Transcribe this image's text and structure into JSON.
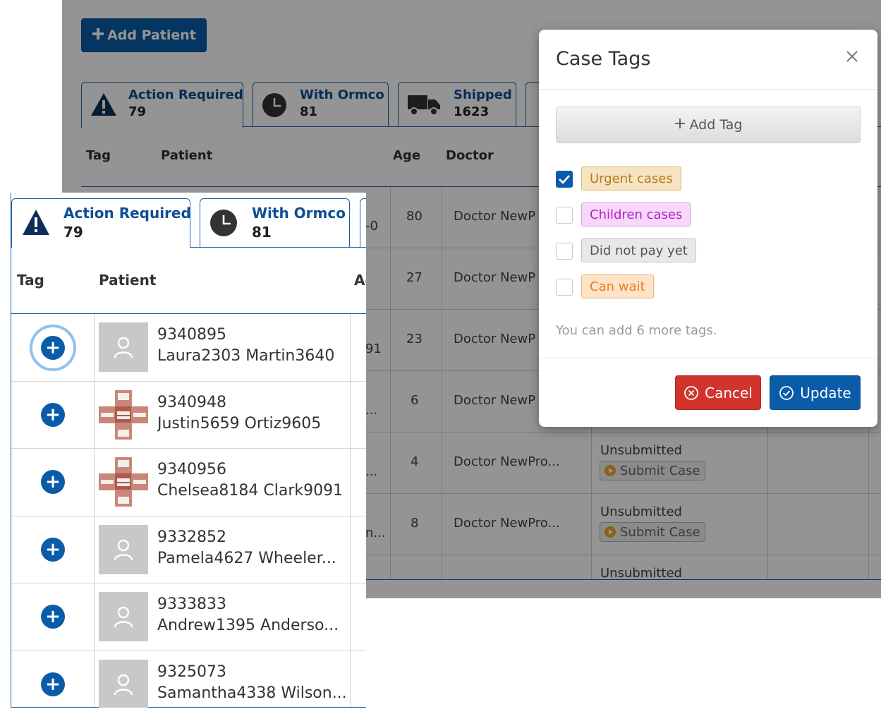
{
  "background": {
    "add_patient_label": "Add Patient",
    "tabs": [
      {
        "label": "Action Required",
        "count": "79",
        "icon": "warning-icon"
      },
      {
        "label": "With Ormco",
        "count": "81",
        "icon": "clock-icon"
      },
      {
        "label": "Shipped",
        "count": "1623",
        "icon": "truck-icon"
      }
    ],
    "columns": {
      "tag": "Tag",
      "patient": "Patient",
      "age": "Age",
      "doctor": "Doctor"
    },
    "rows": [
      {
        "age_frag": "-0",
        "age": "80",
        "doctor": "Doctor NewP"
      },
      {
        "age_frag": "",
        "age": "27",
        "doctor": "Doctor NewP"
      },
      {
        "age_frag": "91",
        "age": "23",
        "doctor": "Doctor NewP"
      },
      {
        "age_frag": "...",
        "age": "6",
        "doctor": "Doctor NewP"
      },
      {
        "age_frag": "...",
        "age": "4",
        "doctor": "Doctor NewPro...",
        "status": "Unsubmitted",
        "action": "Submit Case"
      },
      {
        "age_frag": "n...",
        "age": "8",
        "doctor": "Doctor NewPro...",
        "status": "Unsubmitted",
        "action": "Submit Case"
      },
      {
        "age_frag": "",
        "age": "",
        "doctor": "",
        "status": "Unsubmitted"
      }
    ]
  },
  "foreground": {
    "tabs": [
      {
        "label": "Action Required",
        "count": "79",
        "icon": "warning-icon"
      },
      {
        "label": "With Ormco",
        "count": "81",
        "icon": "clock-icon"
      }
    ],
    "columns": {
      "tag": "Tag",
      "patient": "Patient",
      "age": "Ag"
    },
    "patients": [
      {
        "id": "9340895",
        "name": "Laura2303 Martin3640",
        "photo": "placeholder"
      },
      {
        "id": "9340948",
        "name": "Justin5659 Ortiz9605",
        "photo": "teeth"
      },
      {
        "id": "9340956",
        "name": "Chelsea8184 Clark9091",
        "photo": "teeth"
      },
      {
        "id": "9332852",
        "name": "Pamela4627 Wheeler...",
        "photo": "placeholder"
      },
      {
        "id": "9333833",
        "name": "Andrew1395 Anderso...",
        "photo": "placeholder"
      },
      {
        "id": "9325073",
        "name": "Samantha4338 Wilson...",
        "photo": "placeholder"
      }
    ]
  },
  "modal": {
    "title": "Case Tags",
    "add_tag_label": "Add Tag",
    "tags": [
      {
        "label": "Urgent cases",
        "checked": true,
        "color": "#b07d1e",
        "bg": "#f6e3c1",
        "border": "#d9b777"
      },
      {
        "label": "Children cases",
        "checked": false,
        "color": "#b321c9",
        "bg": "#f7d8fb",
        "border": "#e09aea"
      },
      {
        "label": "Did not pay yet",
        "checked": false,
        "color": "#555555",
        "bg": "#e8e8e8",
        "border": "#c4c4c4"
      },
      {
        "label": "Can wait",
        "checked": false,
        "color": "#e67e22",
        "bg": "#fde3c8",
        "border": "#f0b27a"
      }
    ],
    "hint": "You can add 6 more tags.",
    "cancel_label": "Cancel",
    "update_label": "Update"
  },
  "colors": {
    "primary": "#0a5ca8",
    "danger": "#d0342c"
  }
}
